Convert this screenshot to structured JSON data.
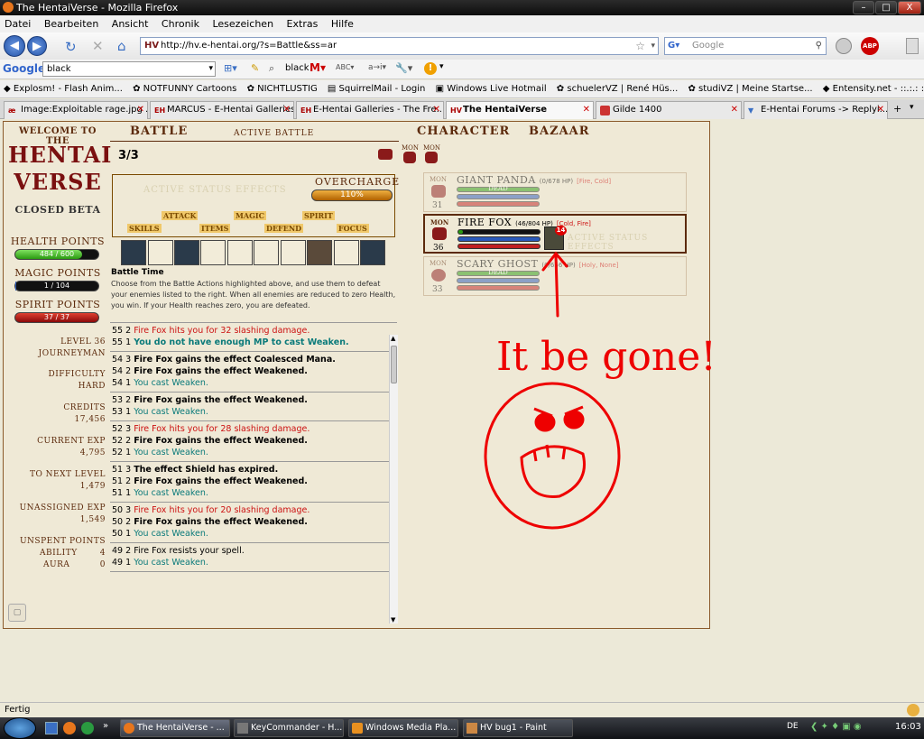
{
  "window": {
    "title": "The HentaiVerse - Mozilla Firefox",
    "min": "–",
    "max": "□",
    "close": "X"
  },
  "menu": [
    "Datei",
    "Bearbeiten",
    "Ansicht",
    "Chronik",
    "Lesezeichen",
    "Extras",
    "Hilfe"
  ],
  "nav": {
    "url": "http://hv.e-hentai.org/?s=Battle&ss=ar",
    "search_placeholder": "Google"
  },
  "googlebar": {
    "label": "Google",
    "query": "black",
    "highlight": "black"
  },
  "bookmarks": [
    "Explosm! - Flash Anim...",
    "NOTFUNNY Cartoons",
    "NICHTLUSTIG",
    "SquirrelMail - Login",
    "Windows Live Hotmail",
    "schuelerVZ | René Hüs...",
    "studiVZ | Meine Startse...",
    "Entensity.net - ::.:.: :. ..."
  ],
  "tabs": [
    {
      "label": "Image:Exploitable rage.jpg ...",
      "icon": "æ"
    },
    {
      "label": "MARCUS - E-Hentai Galleries",
      "icon": "EH"
    },
    {
      "label": "E-Hentai Galleries - The Fre...",
      "icon": "EH"
    },
    {
      "label": "The HentaiVerse",
      "icon": "HV"
    },
    {
      "label": "Gilde 1400",
      "icon": ""
    },
    {
      "label": "E-Hentai Forums -> Replyi...",
      "icon": ""
    }
  ],
  "game": {
    "welcome": "WELCOME TO THE",
    "logo1": "HENTAI",
    "logo2": "VERSE",
    "beta": "CLOSED BETA",
    "nav_battle": "BATTLE",
    "nav_active": "ACTIVE BATTLE",
    "nav_character": "CHARACTER",
    "nav_bazaar": "BAZAAR",
    "round": "3/3",
    "mon1": "MON",
    "mon2": "MON",
    "health_label": "HEALTH POINTS",
    "health": "484 / 600",
    "health_pct": 0.807,
    "magic_label": "MAGIC POINTS",
    "magic": "1 / 104",
    "magic_pct": 0.01,
    "spirit_label": "SPIRIT POINTS",
    "spirit": "37 / 37",
    "spirit_pct": 1.0,
    "level_label": "LEVEL",
    "level": "36",
    "title": "JOURNEYMAN",
    "difficulty_label": "DIFFICULTY",
    "difficulty": "HARD",
    "credits_label": "CREDITS",
    "credits": "17,456",
    "exp_label": "CURRENT EXP",
    "exp": "4,795",
    "next_label": "TO NEXT LEVEL",
    "next": "1,479",
    "unassigned_label": "UNASSIGNED EXP",
    "unassigned": "1,549",
    "unspent_label": "UNSPENT POINTS",
    "ability_label": "ABILITY",
    "ability": "4",
    "aura_label": "AURA",
    "aura": "0",
    "status_effects": "ACTIVE STATUS EFFECTS",
    "overcharge_label": "OVERCHARGE",
    "overcharge": "110%",
    "overcharge_pct": 1.0,
    "actions": [
      "ATTACK",
      "MAGIC",
      "SPIRIT",
      "SKILLS",
      "ITEMS",
      "DEFEND",
      "FOCUS"
    ],
    "battle_time_label": "Battle Time",
    "instructions": "Choose from the Battle Actions highlighted above, and use them to defeat your enemies listed to the right. When all enemies are reduced to zero Health, you win. If your Health reaches zero, you are defeated."
  },
  "log": [
    [
      {
        "n": "55 2",
        "t": "Fire Fox hits you for 32 slashing damage.",
        "c": "red"
      },
      {
        "n": "55 1",
        "t": "You do not have enough MP to cast Weaken.",
        "c": "tealb"
      }
    ],
    [
      {
        "n": "54 3",
        "t": "Fire Fox gains the effect Coalesced Mana.",
        "c": "black"
      },
      {
        "n": "54 2",
        "t": "Fire Fox gains the effect Weakened.",
        "c": "black"
      },
      {
        "n": "54 1",
        "t": "You cast Weaken.",
        "c": "teal"
      }
    ],
    [
      {
        "n": "53 2",
        "t": "Fire Fox gains the effect Weakened.",
        "c": "black"
      },
      {
        "n": "53 1",
        "t": "You cast Weaken.",
        "c": "teal"
      }
    ],
    [
      {
        "n": "52 3",
        "t": "Fire Fox hits you for 28 slashing damage.",
        "c": "red"
      },
      {
        "n": "52 2",
        "t": "Fire Fox gains the effect Weakened.",
        "c": "black"
      },
      {
        "n": "52 1",
        "t": "You cast Weaken.",
        "c": "teal"
      }
    ],
    [
      {
        "n": "51 3",
        "t": "The effect Shield has expired.",
        "c": "black"
      },
      {
        "n": "51 2",
        "t": "Fire Fox gains the effect Weakened.",
        "c": "black"
      },
      {
        "n": "51 1",
        "t": "You cast Weaken.",
        "c": "teal"
      }
    ],
    [
      {
        "n": "50 3",
        "t": "Fire Fox hits you for 20 slashing damage.",
        "c": "red"
      },
      {
        "n": "50 2",
        "t": "Fire Fox gains the effect Weakened.",
        "c": "black"
      },
      {
        "n": "50 1",
        "t": "You cast Weaken.",
        "c": "teal"
      }
    ],
    [
      {
        "n": "49 2",
        "t": "Fire Fox resists your spell.",
        "c": "none"
      },
      {
        "n": "49 1",
        "t": "You cast Weaken.",
        "c": "teal"
      }
    ]
  ],
  "monsters": [
    {
      "tag": "MON",
      "name": "GIANT PANDA",
      "hp": "(0/678 HP)",
      "elem": "[Fire, Cold]",
      "level": "31",
      "dead": "DEAD"
    },
    {
      "tag": "MON",
      "name": "FIRE FOX",
      "hp": "(46/804 HP)",
      "elem": "[Cold, Fire]",
      "level": "36",
      "effect_count": "14",
      "effects": "ACTIVE STATUS EFFECTS"
    },
    {
      "tag": "MON",
      "name": "SCARY GHOST",
      "hp": "(0/656 HP)",
      "elem": "[Holy, None]",
      "level": "33",
      "dead": "DEAD"
    }
  ],
  "doodle_text": "It be gone!",
  "status": "Fertig",
  "taskbar": {
    "items": [
      "The HentaiVerse - ...",
      "KeyCommander - H...",
      "Windows Media Pla...",
      "HV bug1 - Paint"
    ],
    "lang": "DE",
    "time": "16:03"
  }
}
